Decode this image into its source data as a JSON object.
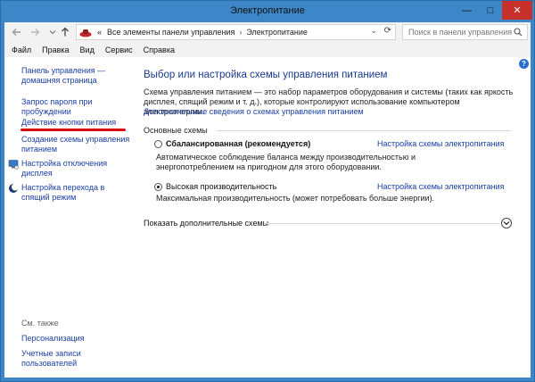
{
  "window": {
    "title": "Электропитание",
    "controls": {
      "minimize": "—",
      "maximize": "□",
      "close": "✕"
    }
  },
  "address_bar": {
    "back_icon": "arrow-left-icon",
    "forward_icon": "arrow-right-icon",
    "up_icon": "arrow-up-icon",
    "overflow": "«",
    "path": [
      "Все элементы панели управления",
      "Электропитание"
    ],
    "separator": "›",
    "dropdown": "⌄",
    "refresh": "⟳",
    "search_placeholder": "Поиск в панели управления"
  },
  "menu": [
    "Файл",
    "Правка",
    "Вид",
    "Сервис",
    "Справка"
  ],
  "sidebar": {
    "links": [
      {
        "label": "Панель управления — домашняя страница"
      },
      {
        "label": "Запрос пароля при пробуждении"
      },
      {
        "label": "Действие кнопки питания"
      },
      {
        "label": "Создание схемы управления питанием"
      },
      {
        "label": "Настройка отключения дисплея",
        "icon": "display-icon"
      },
      {
        "label": "Настройка перехода в спящий режим",
        "icon": "moon-icon"
      }
    ],
    "see_also": "См. также",
    "see_also_links": [
      {
        "label": "Персонализация"
      },
      {
        "label": "Учетные записи пользователей"
      }
    ]
  },
  "main": {
    "heading": "Выбор или настройка схемы управления питанием",
    "intro": "Схема управления питанием — это набор параметров оборудования и системы (таких как яркость дисплея, спящий режим и т. д.), которые контролируют использование компьютером электроэнергии.",
    "intro_link": "Дополнительные сведения о схемах управления питанием",
    "section_label": "Основные схемы",
    "plans": [
      {
        "name": "Сбалансированная (рекомендуется)",
        "selected": false,
        "bold": true,
        "link": "Настройка схемы электропитания",
        "desc": "Автоматическое соблюдение баланса между производительностью и энергопотреблением на пригодном для этого оборудовании."
      },
      {
        "name": "Высокая производительность",
        "selected": true,
        "bold": false,
        "link": "Настройка схемы электропитания",
        "desc": "Максимальная производительность (может потребовать больше энергии)."
      }
    ],
    "more_label": "Показать дополнительные схемы",
    "more_icon": "chevron-down-icon",
    "help": "?"
  },
  "colors": {
    "frame": "#3d87c8",
    "close": "#c7302b",
    "link": "#1a3fa3",
    "heading": "#1b3a8f",
    "annotation": "#d60e0e"
  }
}
